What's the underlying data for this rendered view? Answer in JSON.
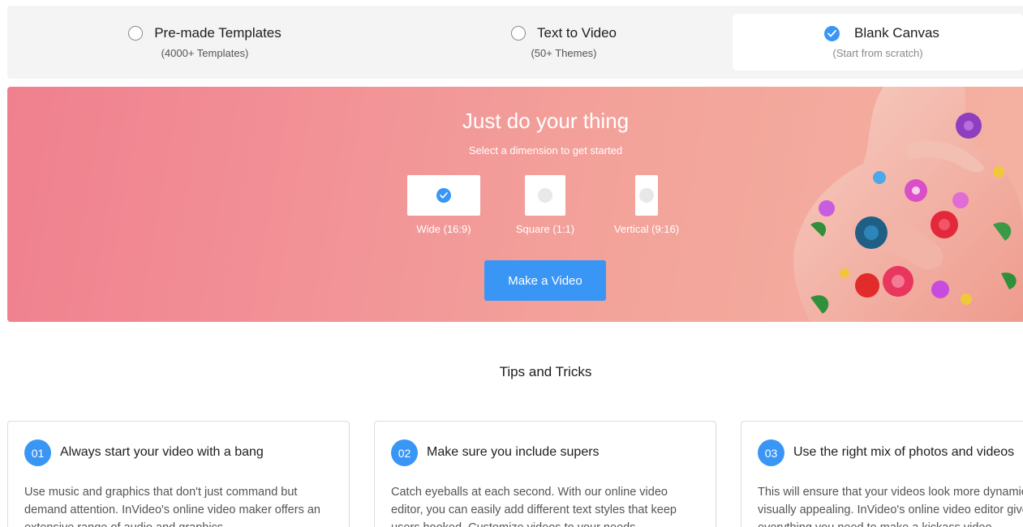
{
  "tabs": [
    {
      "label": "Pre-made Templates",
      "sub": "(4000+ Templates)",
      "selected": false
    },
    {
      "label": "Text to Video",
      "sub": "(50+ Themes)",
      "selected": false
    },
    {
      "label": "Blank Canvas",
      "sub": "(Start from scratch)",
      "selected": true
    }
  ],
  "hero": {
    "title": "Just do your thing",
    "subtitle": "Select a dimension to get started",
    "dimensions": [
      {
        "label": "Wide (16:9)",
        "selected": true
      },
      {
        "label": "Square (1:1)",
        "selected": false
      },
      {
        "label": "Vertical (9:16)",
        "selected": false
      }
    ],
    "button": "Make a Video"
  },
  "tips": {
    "title": "Tips and Tricks",
    "cards": [
      {
        "num": "01",
        "title": "Always start your video with a bang",
        "body": "Use music and graphics that don't just command but demand attention. InVideo's online video maker offers an extensive range of audio and graphics"
      },
      {
        "num": "02",
        "title": "Make sure you include supers",
        "body": "Catch eyeballs at each second. With our online video editor, you can easily add different text styles that keep users hooked. Customize videos to your needs"
      },
      {
        "num": "03",
        "title": "Use the right mix of photos and videos",
        "body": "This will ensure that your videos look more dynamic and visually appealing. InVideo's online video editor gives you everything you need to make a kickass video"
      }
    ]
  },
  "colors": {
    "accent": "#3a96f5",
    "hero_start": "#f0808e",
    "hero_end": "#f4b2a2"
  }
}
